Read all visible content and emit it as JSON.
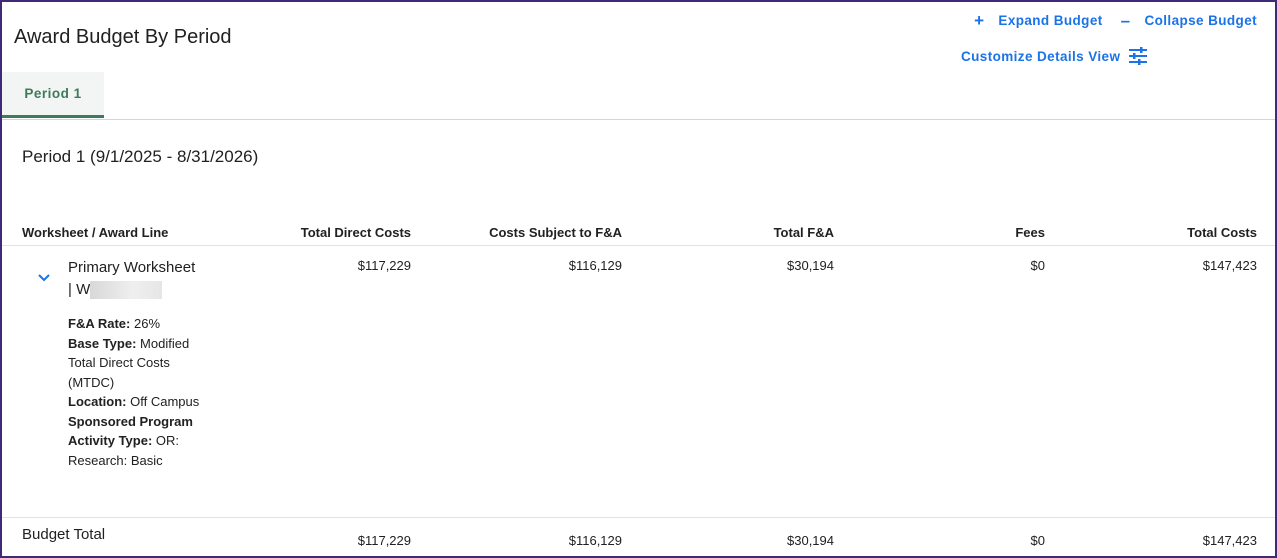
{
  "page": {
    "title": "Award Budget By Period"
  },
  "actions": {
    "expand_label": "Expand Budget",
    "collapse_label": "Collapse Budget",
    "customize_label": "Customize Details View"
  },
  "tabs": [
    {
      "label": "Period 1",
      "active": true
    }
  ],
  "period": {
    "heading": "Period 1 (9/1/2025 - 8/31/2026)"
  },
  "table": {
    "columns": [
      "Worksheet / Award Line",
      "Total Direct Costs",
      "Costs Subject to F&A",
      "Total F&A",
      "Fees",
      "Total Costs"
    ],
    "rows": [
      {
        "name_line1": "Primary Worksheet",
        "name_line2": "| W",
        "values": [
          "$117,229",
          "$116,129",
          "$30,194",
          "$0",
          "$147,423"
        ],
        "details": {
          "fa_rate_label": "F&A Rate:",
          "fa_rate_value": "26%",
          "base_type_label": "Base Type:",
          "base_type_value": "Modified Total Direct Costs (MTDC)",
          "location_label": "Location:",
          "location_value": "Off Campus",
          "activity_label": "Sponsored Program Activity Type:",
          "activity_value": "OR: Research: Basic"
        }
      }
    ],
    "total": {
      "label": "Budget Total",
      "values": [
        "$117,229",
        "$116,129",
        "$30,194",
        "$0",
        "$147,423"
      ]
    }
  },
  "colors": {
    "accent_blue": "#1a73e8",
    "tab_green": "#3e7a5c",
    "frame_purple": "#3f2a78"
  },
  "icons": {
    "expand": "plus-icon",
    "collapse": "minus-icon",
    "customize": "sliders-icon",
    "row_toggle": "chevron-down-icon"
  }
}
